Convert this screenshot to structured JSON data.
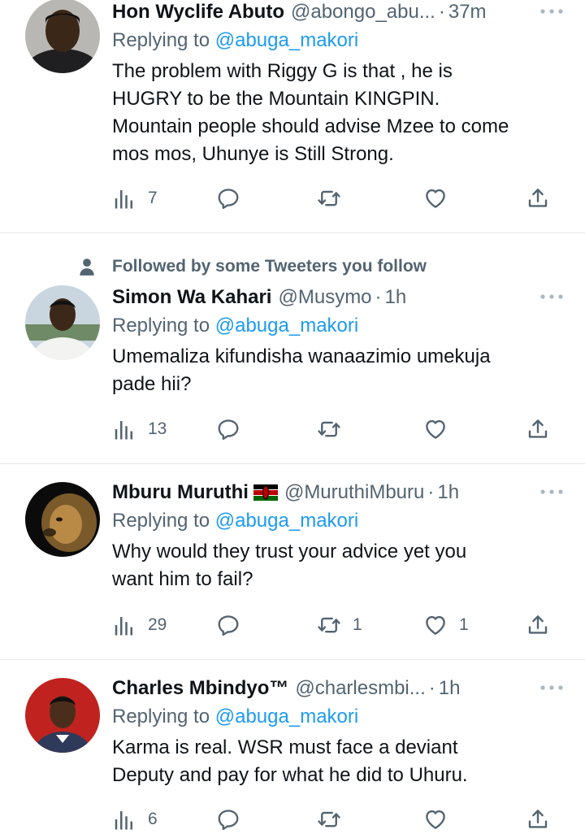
{
  "tweets": [
    {
      "name": "Hon Wyclife Abuto",
      "handle": "@abongo_abu...",
      "time": "37m",
      "reply_prefix": "Replying to",
      "reply_to": "@abuga_makori",
      "text": "The problem with Riggy G is that , he is\nHUGRY to be the Mountain KINGPIN.\nMountain people should advise Mzee to come\nmos mos,  Uhunye is Still Strong.",
      "views": "7",
      "retweets": "",
      "likes": ""
    },
    {
      "social_context": "Followed by some Tweeters you follow",
      "name": "Simon Wa Kahari",
      "handle": "@Musymo",
      "time": "1h",
      "reply_prefix": "Replying to",
      "reply_to": "@abuga_makori",
      "text": "Umemaliza kifundisha wanaazimio umekuja\npade hii?",
      "views": "13",
      "retweets": "",
      "likes": ""
    },
    {
      "name": "Mburu Muruthi",
      "handle": "@MuruthiMburu",
      "time": "1h",
      "reply_prefix": "Replying to",
      "reply_to": "@abuga_makori",
      "text": "Why would they trust your advice yet you\nwant him to fail?",
      "views": "29",
      "retweets": "1",
      "likes": "1"
    },
    {
      "name": "Charles Mbindyo™",
      "handle": "@charlesmbi...",
      "time": "1h",
      "reply_prefix": "Replying to",
      "reply_to": "@abuga_makori",
      "text": "Karma is real. WSR must face a deviant\nDeputy and pay for what he did to Uhuru.",
      "views": "6",
      "retweets": "",
      "likes": ""
    }
  ],
  "icons": {
    "views": "bar-chart-icon",
    "reply": "speech-bubble-icon",
    "retweet": "retweet-icon",
    "like": "heart-icon",
    "share": "share-icon",
    "more": "more-dots-icon",
    "follow": "person-icon",
    "flag": "kenya-flag-icon"
  },
  "colors": {
    "link": "#1d9bf0",
    "muted": "#536471",
    "text": "#0f1419",
    "divider": "#e7e9eb"
  }
}
